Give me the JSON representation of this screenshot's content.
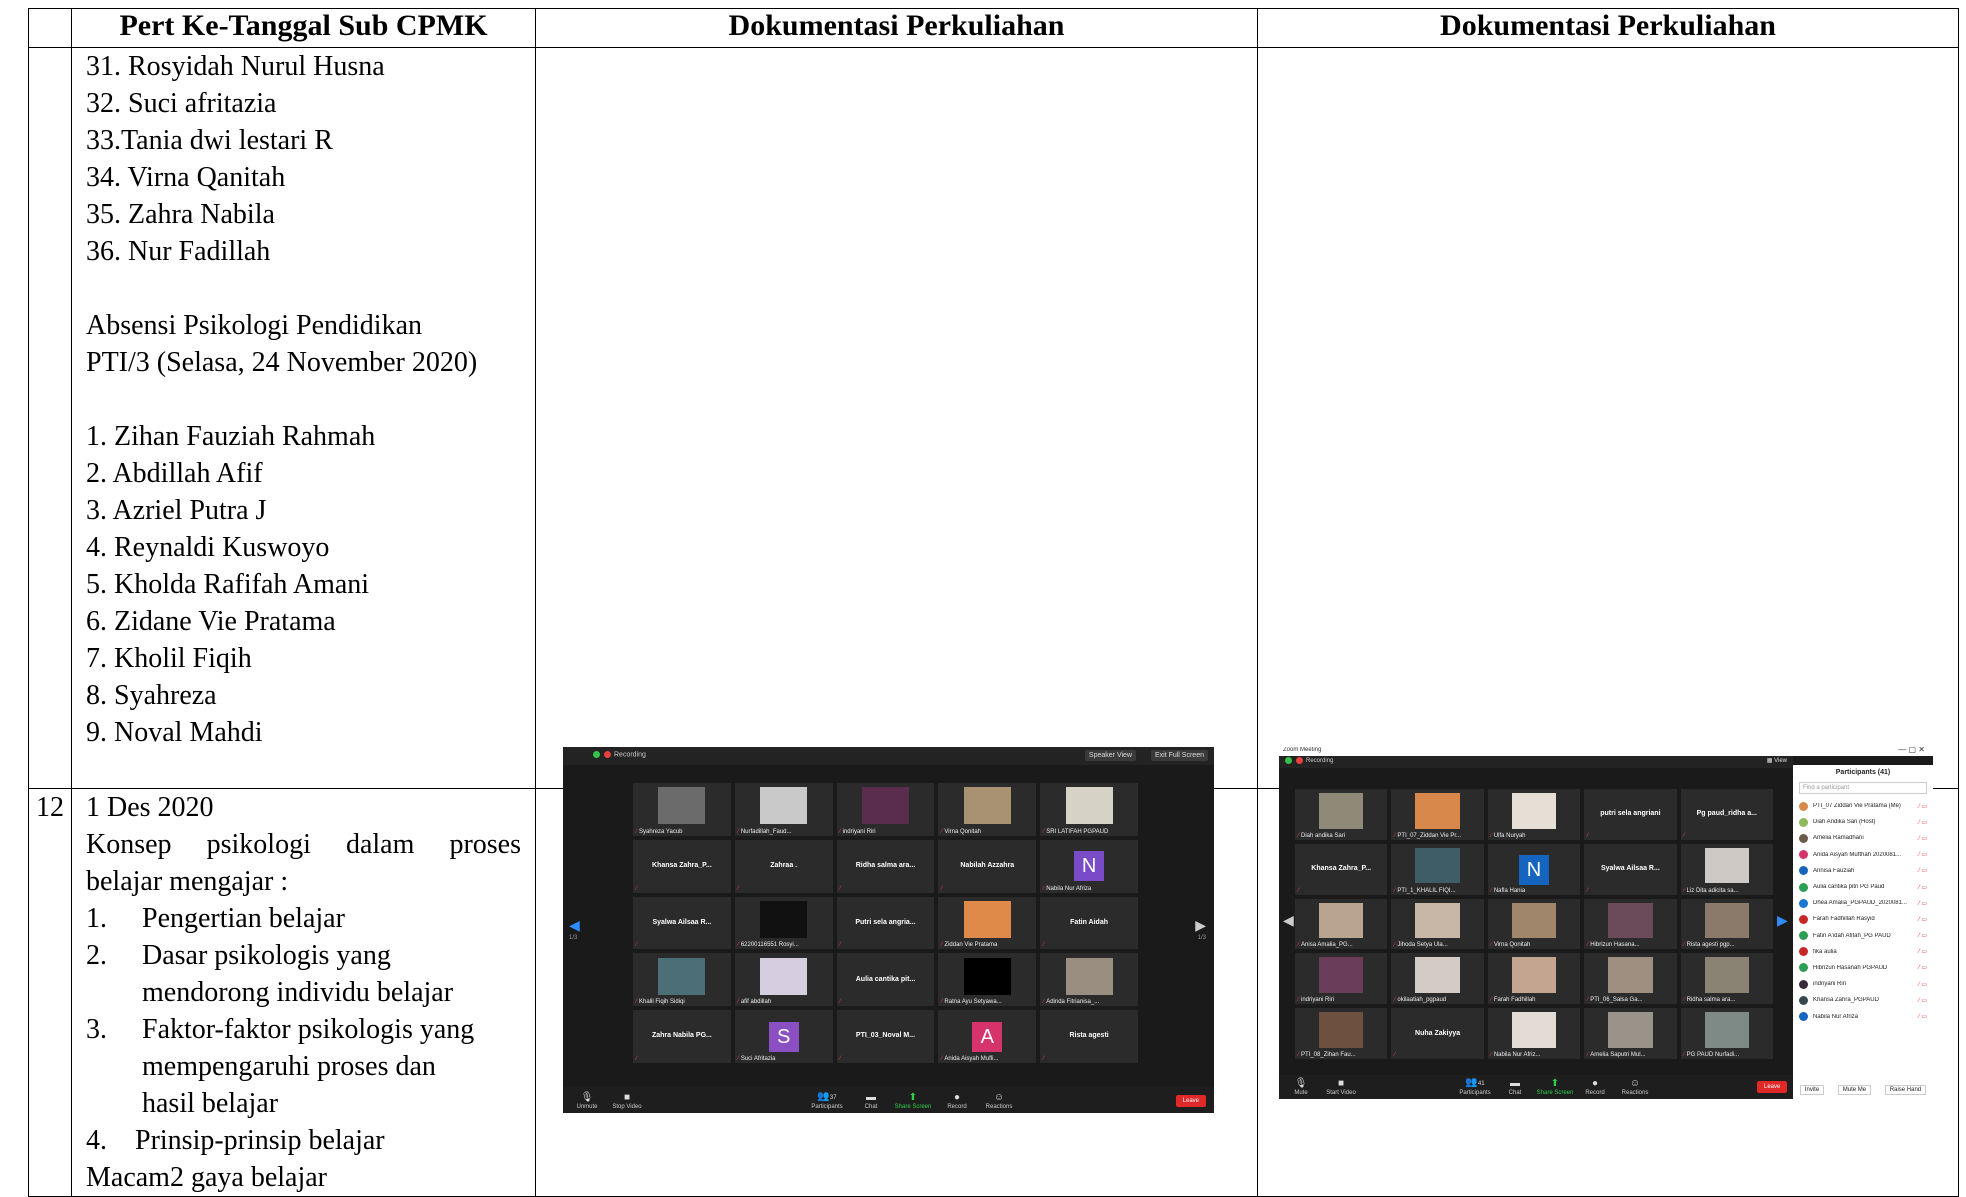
{
  "headers": [
    "",
    "Pert Ke-Tanggal Sub CPMK",
    "Dokumentasi Perkuliahan",
    "Dokumentasi Perkuliahan"
  ],
  "row1": {
    "names_a": [
      "31. Rosyidah Nurul Husna",
      "32. Suci afritazia",
      "33.Tania dwi lestari R",
      "34. Virna Qanitah",
      "35. Zahra Nabila",
      "36. Nur Fadillah"
    ],
    "absensi_line1": "Absensi Psikologi Pendidikan",
    "absensi_line2": "PTI/3 (Selasa, 24 November 2020)",
    "names_b": [
      "1. Zihan Fauziah Rahmah",
      "2. Abdillah Afif",
      "3. Azriel Putra J",
      "4. Reynaldi Kuswoyo",
      "5. Kholda Rafifah Amani",
      "6. Zidane Vie Pratama",
      "7. Kholil Fiqih",
      "8. Syahreza",
      "9. Noval Mahdi"
    ]
  },
  "row2": {
    "number": "12",
    "date": "1 Des 2020",
    "intro_line1": "Konsep psikologi  dalam proses",
    "intro_line2": "belajar mengajar :",
    "items": [
      {
        "n": "1.",
        "lines": [
          "Pengertian belajar"
        ]
      },
      {
        "n": "2.",
        "lines": [
          "Dasar psikologis yang",
          "mendorong individu belajar"
        ]
      },
      {
        "n": "3.",
        "lines": [
          "Faktor-faktor psikologis yang",
          "mempengaruhi proses dan",
          "hasil belajar"
        ]
      }
    ],
    "item4": "4.    Prinsip-prinsip belajar",
    "last_line": "Macam2 gaya belajar"
  },
  "zoom1": {
    "recording": "Recording",
    "speaker_view": "Speaker View",
    "exit_full": "Exit Full Screen",
    "tiles": [
      {
        "name": "Syahreza Yacub",
        "kind": "photo",
        "color": "#6b6b6b"
      },
      {
        "name": "Nurfadillah_Faud...",
        "kind": "photo",
        "color": "#c9c9c9"
      },
      {
        "name": "indriyani Riri",
        "kind": "photo",
        "color": "#5a2d4f"
      },
      {
        "name": "Virna Qonitah",
        "kind": "photo",
        "color": "#a89272"
      },
      {
        "name": "SRI LATIFAH PGPAUD",
        "kind": "photo",
        "color": "#d6d2c6"
      },
      {
        "name": "",
        "center": "Khansa Zahra_P...",
        "kind": "name"
      },
      {
        "name": "",
        "center": "Zahraa .",
        "kind": "name"
      },
      {
        "name": "",
        "center": "Ridha salma ara...",
        "kind": "name"
      },
      {
        "name": "",
        "center": "Nabilah Azzahra",
        "kind": "name"
      },
      {
        "name": "Nabila Nur Afriza",
        "kind": "avatar",
        "letter": "N",
        "color": "#7a4bc9"
      },
      {
        "name": "",
        "center": "Syalwa Ailsaa R...",
        "kind": "name"
      },
      {
        "name": "62200116551 Rosyi...",
        "kind": "photo",
        "color": "#111111"
      },
      {
        "name": "",
        "center": "Putri sela angria...",
        "kind": "name"
      },
      {
        "name": "Ziddan Vie Pratama",
        "kind": "photo",
        "color": "#e08a4a"
      },
      {
        "name": "",
        "center": "Fatin Aidah",
        "kind": "name"
      },
      {
        "name": "Khalil Fiqih Sidiqi",
        "kind": "photo",
        "color": "#4c6e76"
      },
      {
        "name": "afif abdillah",
        "kind": "photo",
        "color": "#d7cde0"
      },
      {
        "name": "",
        "center": "Aulia cantika pit...",
        "kind": "name"
      },
      {
        "name": "Ratna Ayu Setyawa...",
        "kind": "photo",
        "color": "#000000"
      },
      {
        "name": "Adinda Fitrianisa_...",
        "kind": "photo",
        "color": "#9a8e80"
      },
      {
        "name": "",
        "center": "Zahra Nabila PG...",
        "kind": "name"
      },
      {
        "name": "Suci Afritazia",
        "kind": "avatar",
        "letter": "S",
        "color": "#8b4fc4"
      },
      {
        "name": "",
        "center": "PTI_03_Noval M...",
        "kind": "name"
      },
      {
        "name": "Anida Aisyah Mufli...",
        "kind": "avatar",
        "letter": "A",
        "color": "#d6336c"
      },
      {
        "name": "",
        "center": "Rista agesti",
        "kind": "name"
      }
    ],
    "toolbar": [
      "Unmute",
      "Stop Video",
      "Participants",
      "Chat",
      "Share Screen",
      "Record",
      "Reactions"
    ],
    "participants_count": "37",
    "leave": "Leave",
    "page_left": "1/3",
    "page_right": "1/3"
  },
  "zoom2": {
    "window_title": "Zoom Meeting",
    "recording": "Recording",
    "view": "View",
    "tiles": [
      {
        "name": "Diah andika Sari",
        "kind": "photo",
        "color": "#8f8a78"
      },
      {
        "name": "PTI_07_Ziddan Vie Pr...",
        "kind": "photo",
        "color": "#d9884b"
      },
      {
        "name": "Ulfa Nuryah",
        "kind": "photo",
        "color": "#e6dfd6"
      },
      {
        "name": "",
        "center": "putri sela angriani",
        "kind": "name"
      },
      {
        "name": "",
        "center": "Pg paud_ridha a...",
        "kind": "name"
      },
      {
        "name": "",
        "center": "Khansa Zahra_P...",
        "kind": "name"
      },
      {
        "name": "PTI_1_KHALIL FIQI...",
        "kind": "photo",
        "color": "#3e5d66"
      },
      {
        "name": "Nafla Hania",
        "kind": "avatar",
        "letter": "N",
        "color": "#1565c0"
      },
      {
        "name": "",
        "center": "Syalwa Ailsaa R...",
        "kind": "name"
      },
      {
        "name": "Liz Dita adicita sa...",
        "kind": "photo",
        "color": "#cfc9c5"
      },
      {
        "name": "Anisa Amalia_PG...",
        "kind": "photo",
        "color": "#b9a58f"
      },
      {
        "name": "Jihoda Setya Ula...",
        "kind": "photo",
        "color": "#c8b7a6"
      },
      {
        "name": "Virna Qonitah",
        "kind": "photo",
        "color": "#a0876c"
      },
      {
        "name": "Hibrizun Hasana...",
        "kind": "photo",
        "color": "#6b4b5a"
      },
      {
        "name": "Rista agesti pgp...",
        "kind": "photo",
        "color": "#8b7a6a"
      },
      {
        "name": "indriyani Riri",
        "kind": "photo",
        "color": "#6a3d5a"
      },
      {
        "name": "okilaatiah_pgpaud",
        "kind": "photo",
        "color": "#d3cbc5"
      },
      {
        "name": "Farah Fadhillah",
        "kind": "photo",
        "color": "#c4a590"
      },
      {
        "name": "PTI_06_Salsa Ga...",
        "kind": "photo",
        "color": "#9f8f80"
      },
      {
        "name": "Ridha salma ara...",
        "kind": "photo",
        "color": "#8a8272"
      },
      {
        "name": "PTI_08_Zihan Fau...",
        "kind": "photo",
        "color": "#6e5040"
      },
      {
        "name": "",
        "center": "Nuha Zakiyya",
        "kind": "name"
      },
      {
        "name": "Nabila Nur Afriz...",
        "kind": "photo",
        "color": "#e2dcd4"
      },
      {
        "name": "Amelia Saputri Mul...",
        "kind": "photo",
        "color": "#9a938a"
      },
      {
        "name": "PG PAUD Nurfadi...",
        "kind": "photo",
        "color": "#7d8a86"
      }
    ],
    "toolbar": [
      "Mute",
      "Start Video",
      "Participants",
      "Chat",
      "Share Screen",
      "Record",
      "Reactions"
    ],
    "participants_count": "41",
    "leave": "Leave",
    "panel_title": "Participants (41)",
    "find_placeholder": "Find a participant",
    "participants": [
      {
        "name": "PTI_07 Ziddan Vie Pratama (Me)",
        "color": "#d9884b"
      },
      {
        "name": "Diah Andika Sari (Host)",
        "color": "#8db85b"
      },
      {
        "name": "Amelia Ramadhani",
        "color": "#6b5b4b"
      },
      {
        "name": "Anida Aisyah Mufthah 2020081...",
        "color": "#d6336c"
      },
      {
        "name": "Annisa Fauziah",
        "color": "#1565c0"
      },
      {
        "name": "Aulia cantika pitri PG Paud",
        "color": "#2e9e55"
      },
      {
        "name": "Dhea Amalia_PGPAUD_2020081...",
        "color": "#1976d2"
      },
      {
        "name": "Farah Fadhillah Rasyid",
        "color": "#c62828"
      },
      {
        "name": "Fatin A'idah Afifah_PG PAUD",
        "color": "#2e9e55"
      },
      {
        "name": "fika aulia",
        "color": "#c62828"
      },
      {
        "name": "Hibrizun Hasanah PGPAUD",
        "color": "#2e9e55"
      },
      {
        "name": "indriyani Riri",
        "color": "#3a2a3a"
      },
      {
        "name": "Khansa Zahra_PGPAUD",
        "color": "#37474f"
      },
      {
        "name": "Nabila Nur Afriza",
        "color": "#1565c0"
      }
    ],
    "panel_buttons": [
      "Invite",
      "Mute Me",
      "Raise Hand"
    ]
  }
}
